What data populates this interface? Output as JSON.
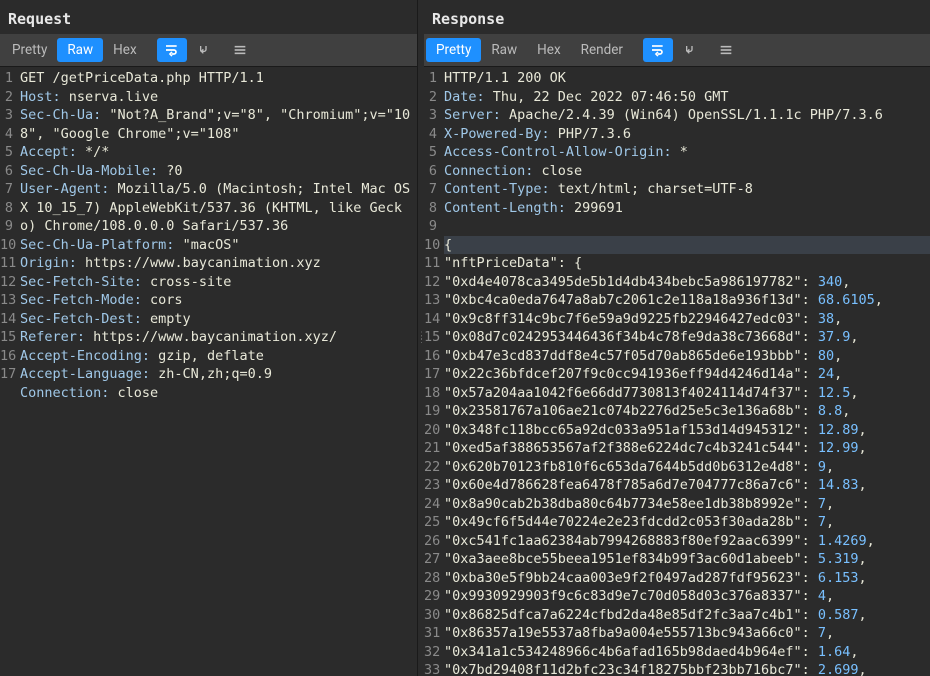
{
  "request": {
    "title": "Request",
    "tabs": [
      "Pretty",
      "Raw",
      "Hex"
    ],
    "activeTab": "Raw",
    "lines": [
      {
        "n": 1,
        "segments": [
          [
            "val",
            "GET /getPriceData.php HTTP/1.1"
          ]
        ]
      },
      {
        "n": 2,
        "segments": [
          [
            "kw",
            "Host:"
          ],
          [
            "val",
            " nserva.live"
          ]
        ]
      },
      {
        "n": 3,
        "segments": [
          [
            "kw",
            "Sec-Ch-Ua:"
          ],
          [
            "val",
            " \"Not?A_Brand\";v=\"8\", \"Chromium\";v=\"108\", \"Google Chrome\";v=\"108\""
          ]
        ]
      },
      {
        "n": 4,
        "segments": [
          [
            "kw",
            "Accept:"
          ],
          [
            "val",
            " */*"
          ]
        ]
      },
      {
        "n": 5,
        "segments": [
          [
            "kw",
            "Sec-Ch-Ua-Mobile:"
          ],
          [
            "val",
            " ?0"
          ]
        ]
      },
      {
        "n": 6,
        "segments": [
          [
            "kw",
            "User-Agent:"
          ],
          [
            "val",
            " Mozilla/5.0 (Macintosh; Intel Mac OS X 10_15_7) AppleWebKit/537.36 (KHTML, like Gecko) Chrome/108.0.0.0 Safari/537.36"
          ]
        ]
      },
      {
        "n": 7,
        "segments": [
          [
            "kw",
            "Sec-Ch-Ua-Platform:"
          ],
          [
            "val",
            " \"macOS\""
          ]
        ]
      },
      {
        "n": 8,
        "segments": [
          [
            "kw",
            "Origin:"
          ],
          [
            "val",
            " https://www.baycanimation.xyz"
          ]
        ]
      },
      {
        "n": 9,
        "segments": [
          [
            "kw",
            "Sec-Fetch-Site:"
          ],
          [
            "val",
            " cross-site"
          ]
        ]
      },
      {
        "n": 10,
        "segments": [
          [
            "kw",
            "Sec-Fetch-Mode:"
          ],
          [
            "val",
            " cors"
          ]
        ]
      },
      {
        "n": 11,
        "segments": [
          [
            "kw",
            "Sec-Fetch-Dest:"
          ],
          [
            "val",
            " empty"
          ]
        ]
      },
      {
        "n": 12,
        "segments": [
          [
            "kw",
            "Referer:"
          ],
          [
            "val",
            " https://www.baycanimation.xyz/"
          ]
        ]
      },
      {
        "n": 13,
        "segments": [
          [
            "kw",
            "Accept-Encoding:"
          ],
          [
            "val",
            " gzip, deflate"
          ]
        ]
      },
      {
        "n": 14,
        "segments": [
          [
            "kw",
            "Accept-Language:"
          ],
          [
            "val",
            " zh-CN,zh;q=0.9"
          ]
        ]
      },
      {
        "n": 15,
        "segments": [
          [
            "kw",
            "Connection:"
          ],
          [
            "val",
            " close"
          ]
        ]
      },
      {
        "n": 16,
        "segments": []
      },
      {
        "n": 17,
        "segments": []
      }
    ]
  },
  "response": {
    "title": "Response",
    "tabs": [
      "Pretty",
      "Raw",
      "Hex",
      "Render"
    ],
    "activeTab": "Pretty",
    "highlightLine": 10,
    "lines": [
      {
        "n": 1,
        "segments": [
          [
            "val",
            "HTTP/1.1 200 OK"
          ]
        ]
      },
      {
        "n": 2,
        "segments": [
          [
            "kw",
            "Date:"
          ],
          [
            "val",
            " Thu, 22 Dec 2022 07:46:50 GMT"
          ]
        ]
      },
      {
        "n": 3,
        "segments": [
          [
            "kw",
            "Server:"
          ],
          [
            "val",
            " Apache/2.4.39 (Win64) OpenSSL/1.1.1c PHP/7.3.6"
          ]
        ]
      },
      {
        "n": 4,
        "segments": [
          [
            "kw",
            "X-Powered-By:"
          ],
          [
            "val",
            " PHP/7.3.6"
          ]
        ]
      },
      {
        "n": 5,
        "segments": [
          [
            "kw",
            "Access-Control-Allow-Origin:"
          ],
          [
            "val",
            " *"
          ]
        ]
      },
      {
        "n": 6,
        "segments": [
          [
            "kw",
            "Connection:"
          ],
          [
            "val",
            " close"
          ]
        ]
      },
      {
        "n": 7,
        "segments": [
          [
            "kw",
            "Content-Type:"
          ],
          [
            "val",
            " text/html; charset=UTF-8"
          ]
        ]
      },
      {
        "n": 8,
        "segments": [
          [
            "kw",
            "Content-Length:"
          ],
          [
            "val",
            " 299691"
          ]
        ]
      },
      {
        "n": 9,
        "segments": []
      },
      {
        "n": 10,
        "segments": [
          [
            "val",
            "{"
          ]
        ]
      },
      {
        "n": 11,
        "segments": [
          [
            "str",
            "\"nftPriceData\""
          ],
          [
            "val",
            ": {"
          ]
        ]
      },
      {
        "n": 12,
        "segments": [
          [
            "str",
            "\"0xd4e4078ca3495de5b1d4db434bebc5a986197782\""
          ],
          [
            "val",
            ": "
          ],
          [
            "num",
            "340"
          ],
          [
            "val",
            ","
          ]
        ]
      },
      {
        "n": 13,
        "segments": [
          [
            "str",
            "\"0xbc4ca0eda7647a8ab7c2061c2e118a18a936f13d\""
          ],
          [
            "val",
            ": "
          ],
          [
            "num",
            "68.6105"
          ],
          [
            "val",
            ","
          ]
        ]
      },
      {
        "n": 14,
        "segments": [
          [
            "str",
            "\"0x9c8ff314c9bc7f6e59a9d9225fb22946427edc03\""
          ],
          [
            "val",
            ": "
          ],
          [
            "num",
            "38"
          ],
          [
            "val",
            ","
          ]
        ]
      },
      {
        "n": 15,
        "segments": [
          [
            "str",
            "\"0x08d7c0242953446436f34b4c78fe9da38c73668d\""
          ],
          [
            "val",
            ": "
          ],
          [
            "num",
            "37.9"
          ],
          [
            "val",
            ","
          ]
        ]
      },
      {
        "n": 16,
        "segments": [
          [
            "str",
            "\"0xb47e3cd837ddf8e4c57f05d70ab865de6e193bbb\""
          ],
          [
            "val",
            ": "
          ],
          [
            "num",
            "80"
          ],
          [
            "val",
            ","
          ]
        ]
      },
      {
        "n": 17,
        "segments": [
          [
            "str",
            "\"0x22c36bfdcef207f9c0cc941936eff94d4246d14a\""
          ],
          [
            "val",
            ": "
          ],
          [
            "num",
            "24"
          ],
          [
            "val",
            ","
          ]
        ]
      },
      {
        "n": 18,
        "segments": [
          [
            "str",
            "\"0x57a204aa1042f6e66dd7730813f4024114d74f37\""
          ],
          [
            "val",
            ": "
          ],
          [
            "num",
            "12.5"
          ],
          [
            "val",
            ","
          ]
        ]
      },
      {
        "n": 19,
        "segments": [
          [
            "str",
            "\"0x23581767a106ae21c074b2276d25e5c3e136a68b\""
          ],
          [
            "val",
            ": "
          ],
          [
            "num",
            "8.8"
          ],
          [
            "val",
            ","
          ]
        ]
      },
      {
        "n": 20,
        "segments": [
          [
            "str",
            "\"0x348fc118bcc65a92dc033a951af153d14d945312\""
          ],
          [
            "val",
            ": "
          ],
          [
            "num",
            "12.89"
          ],
          [
            "val",
            ","
          ]
        ]
      },
      {
        "n": 21,
        "segments": [
          [
            "str",
            "\"0xed5af388653567af2f388e6224dc7c4b3241c544\""
          ],
          [
            "val",
            ": "
          ],
          [
            "num",
            "12.99"
          ],
          [
            "val",
            ","
          ]
        ]
      },
      {
        "n": 22,
        "segments": [
          [
            "str",
            "\"0x620b70123fb810f6c653da7644b5dd0b6312e4d8\""
          ],
          [
            "val",
            ": "
          ],
          [
            "num",
            "9"
          ],
          [
            "val",
            ","
          ]
        ]
      },
      {
        "n": 23,
        "segments": [
          [
            "str",
            "\"0x60e4d786628fea6478f785a6d7e704777c86a7c6\""
          ],
          [
            "val",
            ": "
          ],
          [
            "num",
            "14.83"
          ],
          [
            "val",
            ","
          ]
        ]
      },
      {
        "n": 24,
        "segments": [
          [
            "str",
            "\"0x8a90cab2b38dba80c64b7734e58ee1db38b8992e\""
          ],
          [
            "val",
            ": "
          ],
          [
            "num",
            "7"
          ],
          [
            "val",
            ","
          ]
        ]
      },
      {
        "n": 25,
        "segments": [
          [
            "str",
            "\"0x49cf6f5d44e70224e2e23fdcdd2c053f30ada28b\""
          ],
          [
            "val",
            ": "
          ],
          [
            "num",
            "7"
          ],
          [
            "val",
            ","
          ]
        ]
      },
      {
        "n": 26,
        "segments": [
          [
            "str",
            "\"0xc541fc1aa62384ab7994268883f80ef92aac6399\""
          ],
          [
            "val",
            ": "
          ],
          [
            "num",
            "1.4269"
          ],
          [
            "val",
            ","
          ]
        ]
      },
      {
        "n": 27,
        "segments": [
          [
            "str",
            "\"0xa3aee8bce55beea1951ef834b99f3ac60d1abeeb\""
          ],
          [
            "val",
            ": "
          ],
          [
            "num",
            "5.319"
          ],
          [
            "val",
            ","
          ]
        ]
      },
      {
        "n": 28,
        "segments": [
          [
            "str",
            "\"0xba30e5f9bb24caa003e9f2f0497ad287fdf95623\""
          ],
          [
            "val",
            ": "
          ],
          [
            "num",
            "6.153"
          ],
          [
            "val",
            ","
          ]
        ]
      },
      {
        "n": 29,
        "segments": [
          [
            "str",
            "\"0x9930929903f9c6c83d9e7c70d058d03c376a8337\""
          ],
          [
            "val",
            ": "
          ],
          [
            "num",
            "4"
          ],
          [
            "val",
            ","
          ]
        ]
      },
      {
        "n": 30,
        "segments": [
          [
            "str",
            "\"0x86825dfca7a6224cfbd2da48e85df2fc3aa7c4b1\""
          ],
          [
            "val",
            ": "
          ],
          [
            "num",
            "0.587"
          ],
          [
            "val",
            ","
          ]
        ]
      },
      {
        "n": 31,
        "segments": [
          [
            "str",
            "\"0x86357a19e5537a8fba9a004e555713bc943a66c0\""
          ],
          [
            "val",
            ": "
          ],
          [
            "num",
            "7"
          ],
          [
            "val",
            ","
          ]
        ]
      },
      {
        "n": 32,
        "segments": [
          [
            "str",
            "\"0x341a1c534248966c4b6afad165b98daed4b964ef\""
          ],
          [
            "val",
            ": "
          ],
          [
            "num",
            "1.64"
          ],
          [
            "val",
            ","
          ]
        ]
      },
      {
        "n": 33,
        "segments": [
          [
            "str",
            "\"0x7bd29408f11d2bfc23c34f18275bbf23bb716bc7\""
          ],
          [
            "val",
            ": "
          ],
          [
            "num",
            "2.699"
          ],
          [
            "val",
            ","
          ]
        ]
      }
    ]
  }
}
